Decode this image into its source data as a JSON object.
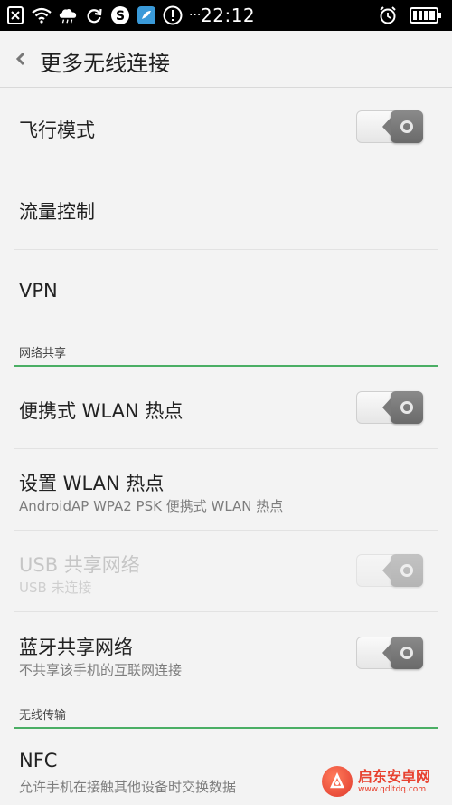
{
  "statusbar": {
    "time": "22:12",
    "dots": "···",
    "left_icons": [
      "close-box-icon",
      "wifi-icon",
      "weather-cloud-icon",
      "refresh-icon",
      "sync-s-icon",
      "app-shield-icon",
      "alert-icon"
    ],
    "right_icons": [
      "alarm-icon",
      "battery-icon"
    ]
  },
  "header": {
    "title": "更多无线连接"
  },
  "items": [
    {
      "label": "飞行模式"
    },
    {
      "label": "流量控制"
    },
    {
      "label": "VPN"
    }
  ],
  "sections": [
    {
      "title": "网络共享"
    },
    {
      "title": "无线传输"
    }
  ],
  "tether": [
    {
      "label": "便携式 WLAN 热点"
    },
    {
      "label": "设置 WLAN 热点",
      "sub": "AndroidAP WPA2 PSK 便携式 WLAN 热点"
    },
    {
      "label": "USB 共享网络",
      "sub": "USB 未连接"
    },
    {
      "label": "蓝牙共享网络",
      "sub": "不共享该手机的互联网连接"
    }
  ],
  "wireless": [
    {
      "label": "NFC",
      "sub": "允许手机在接触其他设备时交换数据"
    }
  ],
  "toggles": {
    "airplane": false,
    "hotspot": false,
    "usb": false,
    "bluetooth": false
  },
  "watermark": {
    "text": "启东安卓网",
    "sub": "www.qdltdq.com"
  },
  "colors": {
    "accent": "#4aae64",
    "statusbar": "#000000",
    "background": "#f3f3f3"
  }
}
